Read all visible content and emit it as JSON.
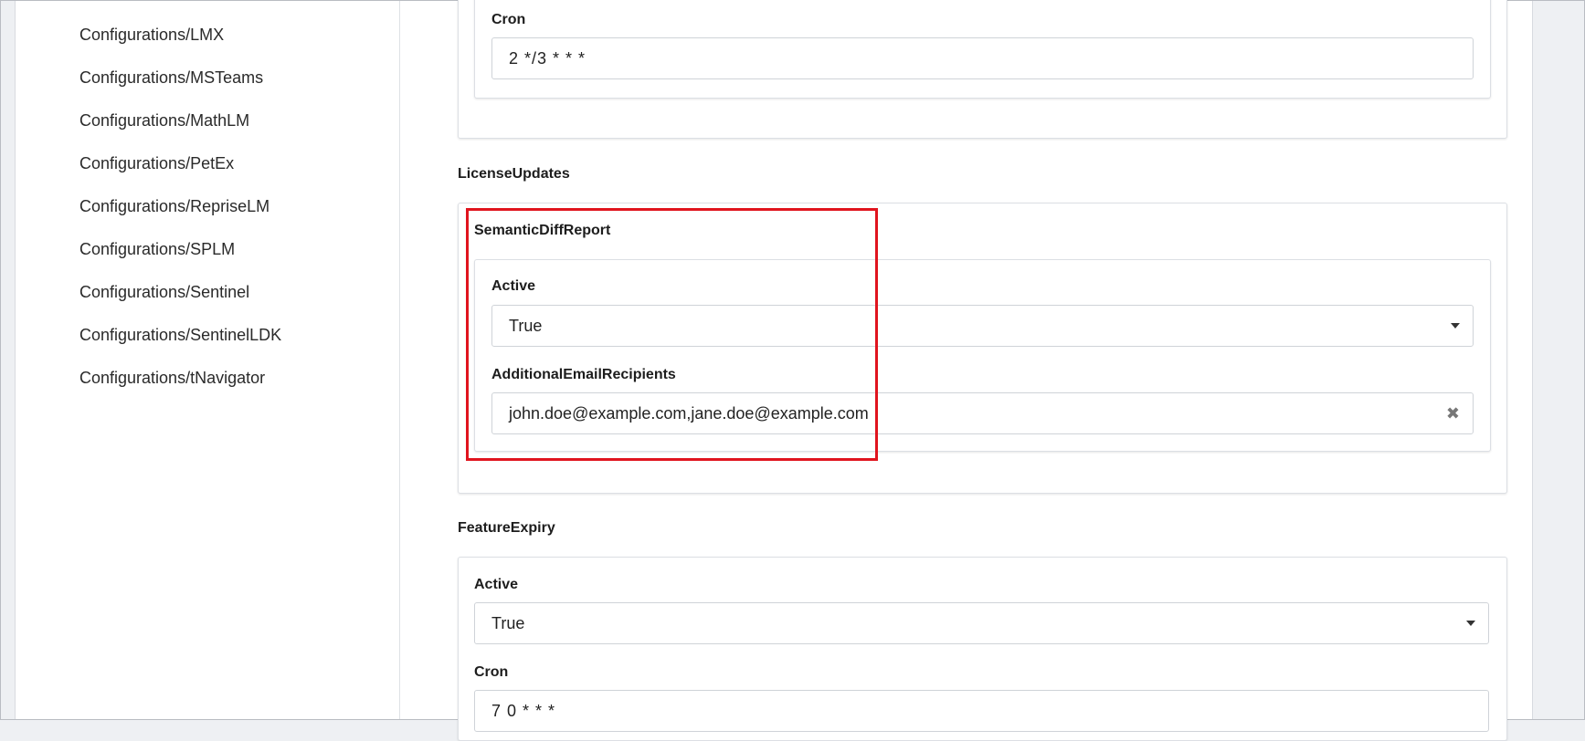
{
  "sidebar": {
    "items": [
      {
        "label": "Configurations/LMX"
      },
      {
        "label": "Configurations/MSTeams"
      },
      {
        "label": "Configurations/MathLM"
      },
      {
        "label": "Configurations/PetEx"
      },
      {
        "label": "Configurations/RepriseLM"
      },
      {
        "label": "Configurations/SPLM"
      },
      {
        "label": "Configurations/Sentinel"
      },
      {
        "label": "Configurations/SentinelLDK"
      },
      {
        "label": "Configurations/tNavigator"
      }
    ]
  },
  "top_section": {
    "cron_label": "Cron",
    "cron_value": "2 */3 * * *"
  },
  "license_updates": {
    "heading": "LicenseUpdates",
    "semantic_diff": {
      "heading": "SemanticDiffReport",
      "active_label": "Active",
      "active_value": "True",
      "recipients_label": "AdditionalEmailRecipients",
      "recipients_value": "john.doe@example.com,jane.doe@example.com"
    }
  },
  "feature_expiry": {
    "heading": "FeatureExpiry",
    "active_label": "Active",
    "active_value": "True",
    "cron_label": "Cron",
    "cron_value": "7 0 * * *"
  },
  "icons": {
    "dropdown": "chevron-down-icon",
    "clear": "clear-icon"
  },
  "colors": {
    "highlight": "#e0141e",
    "background": "#eef0f3"
  }
}
